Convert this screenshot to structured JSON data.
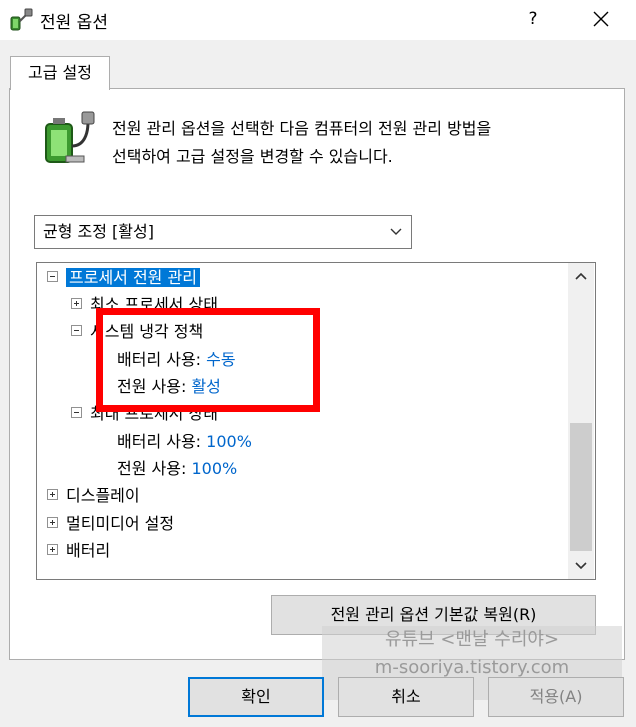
{
  "window": {
    "title": "전원 옵션",
    "help_label": "?"
  },
  "tab": {
    "label": "고급 설정"
  },
  "description": {
    "line1": "전원 관리 옵션을 선택한 다음 컴퓨터의 전원 관리 방법을",
    "line2": "선택하여 고급 설정을 변경할 수 있습니다."
  },
  "plan_select": {
    "value": "균형 조정 [활성]"
  },
  "tree": {
    "processor": {
      "label": "프로세서 전원 관리"
    },
    "min_state": {
      "label": "최소 프로세서 상태"
    },
    "cooling": {
      "label": "시스템 냉각 정책",
      "battery_label": "배터리 사용:",
      "battery_value": "수동",
      "plugged_label": "전원 사용:",
      "plugged_value": "활성"
    },
    "max_state": {
      "label": "최대 프로세서 상태",
      "battery_label": "배터리 사용:",
      "battery_value": "100%",
      "plugged_label": "전원 사용:",
      "plugged_value": "100%"
    },
    "display": {
      "label": "디스플레이"
    },
    "multimedia": {
      "label": "멀티미디어 설정"
    },
    "battery": {
      "label": "배터리"
    }
  },
  "buttons": {
    "restore": "전원 관리 옵션 기본값 복원(R)",
    "ok": "확인",
    "cancel": "취소",
    "apply": "적용(A)"
  },
  "watermark": {
    "line1": "유튜브 <맨날 수리야>",
    "line2": "m-sooriya.tistory.com"
  },
  "colors": {
    "selection": "#0078d7",
    "value_link": "#0066cc",
    "highlight_box": "#ff0000"
  }
}
